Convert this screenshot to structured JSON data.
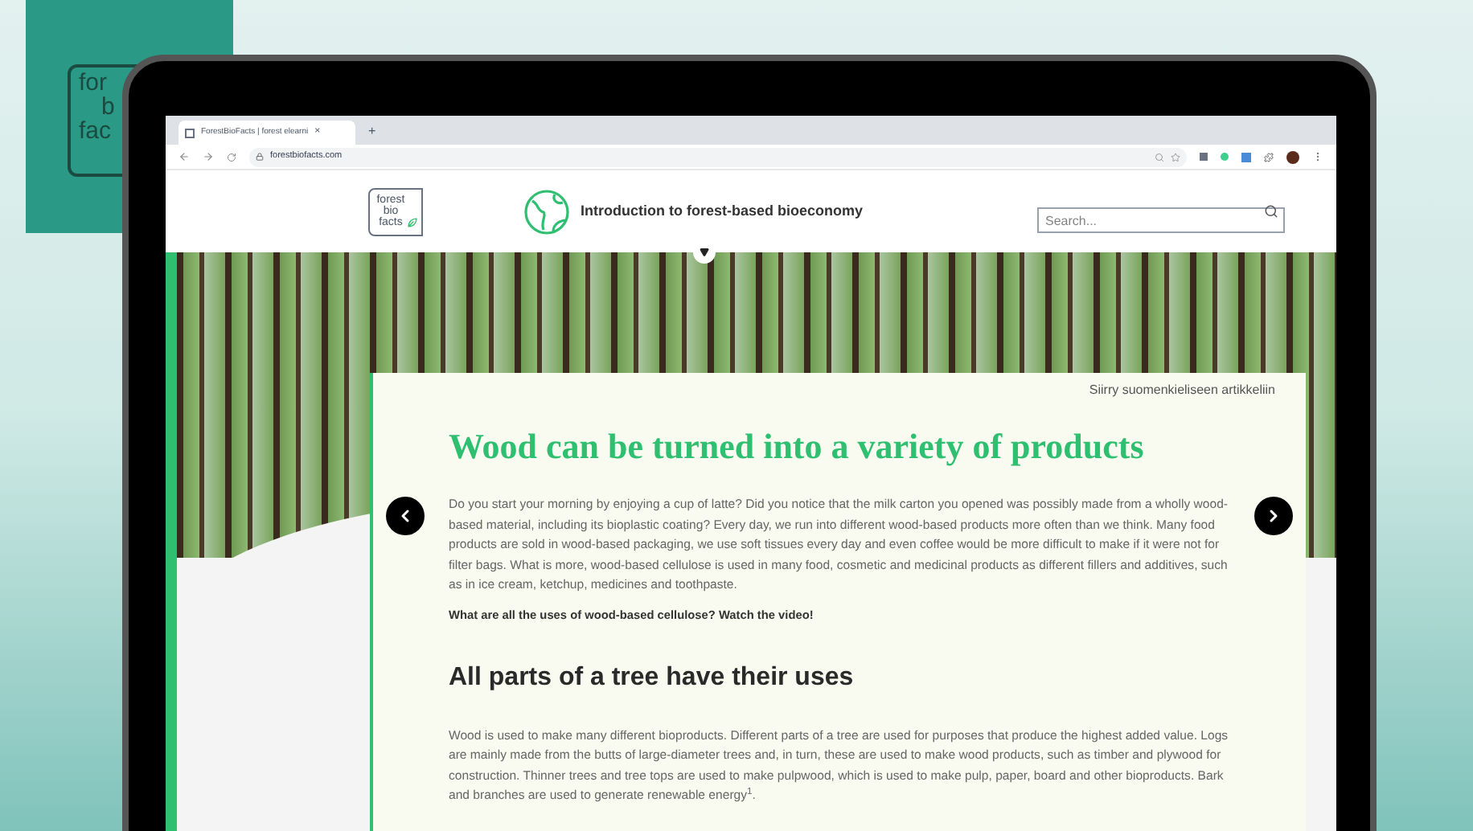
{
  "brand_card": {
    "logo_lines": [
      "for",
      "b",
      "fac"
    ]
  },
  "browser": {
    "tab": {
      "title": "ForestBioFacts | forest elearni",
      "close": "×"
    },
    "new_tab": "+",
    "url": "forestbiofacts.com"
  },
  "header": {
    "logo_lines": [
      "forest",
      "bio",
      "facts"
    ],
    "course_title": "Introduction to forest-based bioeconomy",
    "search": {
      "placeholder": "Search..."
    }
  },
  "article": {
    "language_link": "Siirry suomenkieliseen artikkeliin",
    "title": "Wood can be turned into a variety of products",
    "intro": "Do you start your morning by enjoying a cup of latte? Did you notice that the milk carton you opened was possibly made from a wholly wood-based material, including its bioplastic coating? Every day, we run into different wood-based products more often than we think. Many food products are sold in wood-based packaging, we use soft tissues every day and even coffee would be more difficult to make if it were not for filter bags. What is more, wood-based cellulose is used in many food, cosmetic and medicinal products as different fillers and additives, such as in ice cream, ketchup, medicines and toothpaste.",
    "video_prompt": "What are all the uses of wood-based cellulose? Watch the video!",
    "section_title": "All parts of a tree have their uses",
    "section_text": "Wood is used to make many different bioproducts. Different parts of a tree are used for purposes that produce the highest added value. Logs are mainly made from the butts of large-diameter trees and, in turn, these are used to make wood products, such as timber and plywood for construction. Thinner trees and tree tops are used to make pulpwood, which is used to make pulp, paper, board and other bioproducts. Bark and branches are used to generate renewable energy$^{1}$."
  }
}
